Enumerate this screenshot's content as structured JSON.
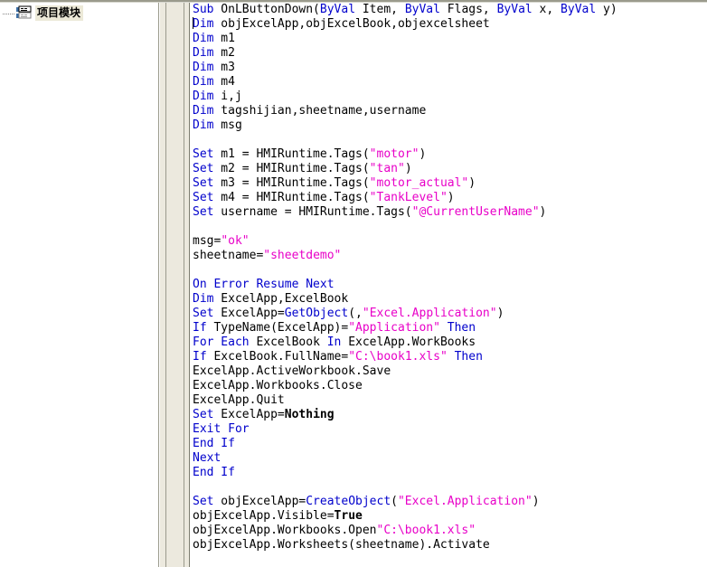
{
  "window": {
    "left_panel_name": "project-tree",
    "editor_name": "vbscript-code-editor"
  },
  "tree": {
    "items": [
      {
        "label": "项目模块",
        "icon": "module-icon",
        "selected": true
      }
    ]
  },
  "colors": {
    "keyword": "#0000cc",
    "string": "#e800c8",
    "identifier": "#000000",
    "constant": "#000000",
    "gutter": "#ece9de",
    "selection": "#ece9d8",
    "border": "#9a9a8c",
    "editor_background": "#ffffff"
  },
  "code": {
    "language": "VBScript",
    "lines": [
      [
        {
          "t": "kw",
          "v": "Sub"
        },
        {
          "t": "id",
          "v": " OnLButtonDown("
        },
        {
          "t": "kw",
          "v": "ByVal"
        },
        {
          "t": "id",
          "v": " Item, "
        },
        {
          "t": "kw",
          "v": "ByVal"
        },
        {
          "t": "id",
          "v": " Flags, "
        },
        {
          "t": "kw",
          "v": "ByVal"
        },
        {
          "t": "id",
          "v": " x, "
        },
        {
          "t": "kw",
          "v": "ByVal"
        },
        {
          "t": "id",
          "v": " y)"
        }
      ],
      [
        {
          "t": "kw",
          "v": "Dim"
        },
        {
          "t": "id",
          "v": " objExcelApp,objExcelBook,objexcelsheet"
        }
      ],
      [
        {
          "t": "kw",
          "v": "Dim"
        },
        {
          "t": "id",
          "v": " m1"
        }
      ],
      [
        {
          "t": "kw",
          "v": "Dim"
        },
        {
          "t": "id",
          "v": " m2"
        }
      ],
      [
        {
          "t": "kw",
          "v": "Dim"
        },
        {
          "t": "id",
          "v": " m3"
        }
      ],
      [
        {
          "t": "kw",
          "v": "Dim"
        },
        {
          "t": "id",
          "v": " m4"
        }
      ],
      [
        {
          "t": "kw",
          "v": "Dim"
        },
        {
          "t": "id",
          "v": " i,j"
        }
      ],
      [
        {
          "t": "kw",
          "v": "Dim"
        },
        {
          "t": "id",
          "v": " tagshijian,sheetname,username"
        }
      ],
      [
        {
          "t": "kw",
          "v": "Dim"
        },
        {
          "t": "id",
          "v": " msg"
        }
      ],
      [],
      [
        {
          "t": "kw",
          "v": "Set"
        },
        {
          "t": "id",
          "v": " m1 = HMIRuntime.Tags("
        },
        {
          "t": "str",
          "v": "\"motor\""
        },
        {
          "t": "id",
          "v": ")"
        }
      ],
      [
        {
          "t": "kw",
          "v": "Set"
        },
        {
          "t": "id",
          "v": " m2 = HMIRuntime.Tags("
        },
        {
          "t": "str",
          "v": "\"tan\""
        },
        {
          "t": "id",
          "v": ")"
        }
      ],
      [
        {
          "t": "kw",
          "v": "Set"
        },
        {
          "t": "id",
          "v": " m3 = HMIRuntime.Tags("
        },
        {
          "t": "str",
          "v": "\"motor_actual\""
        },
        {
          "t": "id",
          "v": ")"
        }
      ],
      [
        {
          "t": "kw",
          "v": "Set"
        },
        {
          "t": "id",
          "v": " m4 = HMIRuntime.Tags("
        },
        {
          "t": "str",
          "v": "\"TankLevel\""
        },
        {
          "t": "id",
          "v": ")"
        }
      ],
      [
        {
          "t": "kw",
          "v": "Set"
        },
        {
          "t": "id",
          "v": " username = HMIRuntime.Tags("
        },
        {
          "t": "str",
          "v": "\"@CurrentUserName\""
        },
        {
          "t": "id",
          "v": ")"
        }
      ],
      [],
      [
        {
          "t": "id",
          "v": "msg="
        },
        {
          "t": "str",
          "v": "\"ok\""
        }
      ],
      [
        {
          "t": "id",
          "v": "sheetname="
        },
        {
          "t": "str",
          "v": "\"sheetdemo\""
        }
      ],
      [],
      [
        {
          "t": "kw",
          "v": "On Error Resume Next"
        }
      ],
      [
        {
          "t": "kw",
          "v": "Dim"
        },
        {
          "t": "id",
          "v": " ExcelApp,ExcelBook"
        }
      ],
      [
        {
          "t": "kw",
          "v": "Set"
        },
        {
          "t": "id",
          "v": " ExcelApp="
        },
        {
          "t": "kw",
          "v": "GetObject"
        },
        {
          "t": "id",
          "v": "(,"
        },
        {
          "t": "str",
          "v": "\"Excel.Application\""
        },
        {
          "t": "id",
          "v": ")"
        }
      ],
      [
        {
          "t": "kw",
          "v": "If"
        },
        {
          "t": "id",
          "v": " TypeName(ExcelApp)="
        },
        {
          "t": "str",
          "v": "\"Application\""
        },
        {
          "t": "kw",
          "v": " Then"
        }
      ],
      [
        {
          "t": "kw",
          "v": "For Each"
        },
        {
          "t": "id",
          "v": " ExcelBook "
        },
        {
          "t": "kw",
          "v": "In"
        },
        {
          "t": "id",
          "v": " ExcelApp.WorkBooks"
        }
      ],
      [
        {
          "t": "kw",
          "v": "If"
        },
        {
          "t": "id",
          "v": " ExcelBook.FullName="
        },
        {
          "t": "str",
          "v": "\"C:\\book1.xls\""
        },
        {
          "t": "kw",
          "v": " Then"
        }
      ],
      [
        {
          "t": "id",
          "v": "ExcelApp.ActiveWorkbook.Save"
        }
      ],
      [
        {
          "t": "id",
          "v": "ExcelApp.Workbooks.Close"
        }
      ],
      [
        {
          "t": "id",
          "v": "ExcelApp.Quit"
        }
      ],
      [
        {
          "t": "kw",
          "v": "Set"
        },
        {
          "t": "id",
          "v": " ExcelApp="
        },
        {
          "t": "cst",
          "v": "Nothing"
        }
      ],
      [
        {
          "t": "kw",
          "v": "Exit For"
        }
      ],
      [
        {
          "t": "kw",
          "v": "End If"
        }
      ],
      [
        {
          "t": "kw",
          "v": "Next"
        }
      ],
      [
        {
          "t": "kw",
          "v": "End If"
        }
      ],
      [],
      [
        {
          "t": "kw",
          "v": "Set"
        },
        {
          "t": "id",
          "v": " objExcelApp="
        },
        {
          "t": "kw",
          "v": "CreateObject"
        },
        {
          "t": "id",
          "v": "("
        },
        {
          "t": "str",
          "v": "\"Excel.Application\""
        },
        {
          "t": "id",
          "v": ")"
        }
      ],
      [
        {
          "t": "id",
          "v": "objExcelApp.Visible="
        },
        {
          "t": "cst",
          "v": "True"
        }
      ],
      [
        {
          "t": "id",
          "v": "objExcelApp.Workbooks.Open"
        },
        {
          "t": "str",
          "v": "\"C:\\book1.xls\""
        }
      ],
      [
        {
          "t": "id",
          "v": "objExcelApp.Worksheets(sheetname).Activate"
        }
      ]
    ]
  }
}
